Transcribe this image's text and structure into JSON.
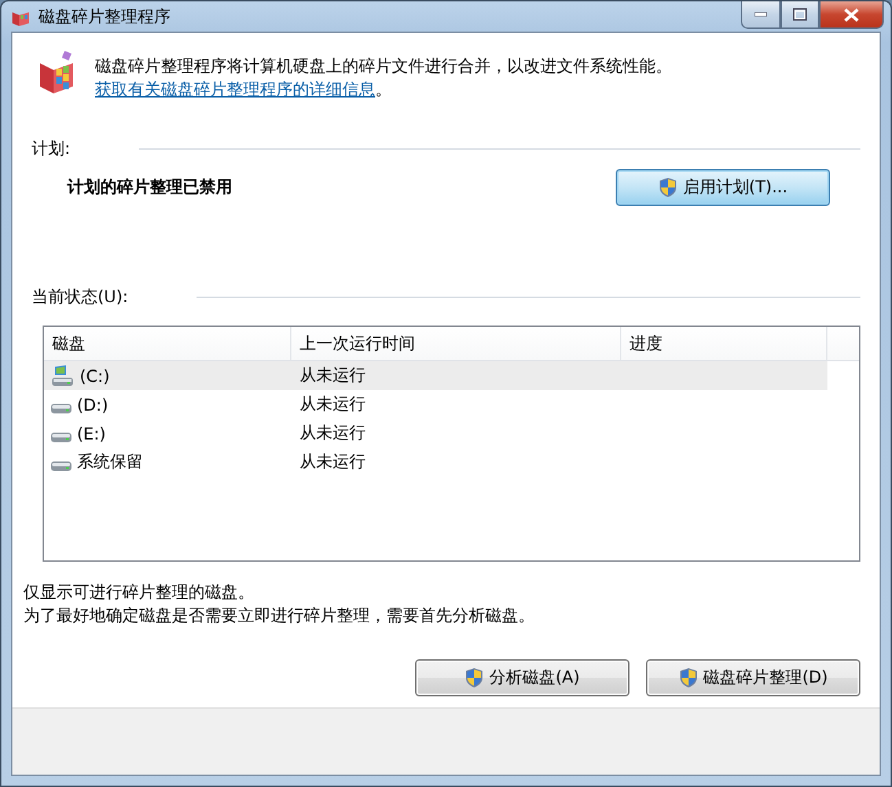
{
  "window": {
    "title": "磁盘碎片整理程序"
  },
  "intro": {
    "text": "磁盘碎片整理程序将计算机硬盘上的碎片文件进行合并，以改进文件系统性能。",
    "link": "获取有关磁盘碎片整理程序的详细信息",
    "end": "。"
  },
  "schedule": {
    "heading": "计划:",
    "status": "计划的碎片整理已禁用",
    "button": {
      "label": "启用计划(T)...",
      "focused": true
    }
  },
  "current_status": {
    "heading": "当前状态(U):"
  },
  "table": {
    "columns": [
      "磁盘",
      "上一次运行时间",
      "进度"
    ],
    "rows": [
      {
        "disk": "(C:)",
        "kind": "system",
        "last_run": "从未运行",
        "selected": true
      },
      {
        "disk": "(D:)",
        "kind": "drive",
        "last_run": "从未运行",
        "selected": false
      },
      {
        "disk": "(E:)",
        "kind": "drive",
        "last_run": "从未运行",
        "selected": false
      },
      {
        "disk": "系统保留",
        "kind": "drive",
        "last_run": "从未运行",
        "selected": false
      }
    ]
  },
  "notes": [
    "仅显示可进行碎片整理的磁盘。",
    "为了最好地确定磁盘是否需要立即进行碎片整理，需要首先分析磁盘。"
  ],
  "buttons": [
    {
      "label": "分析磁盘(A)",
      "focused": false
    },
    {
      "label": "磁盘碎片整理(D)",
      "focused": false
    }
  ]
}
